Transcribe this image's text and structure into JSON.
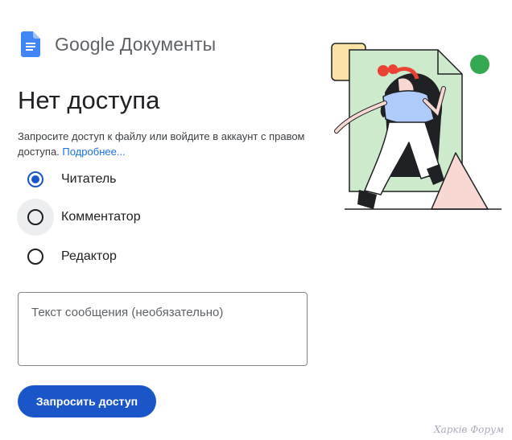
{
  "brand": {
    "google": "Google",
    "product": "Документы",
    "logo_icon": "google-docs-icon"
  },
  "title": "Нет доступа",
  "description": {
    "text": "Запросите доступ к файлу или войдите в аккаунт с правом доступа.",
    "link": "Подробнее..."
  },
  "roles": [
    {
      "label": "Читатель",
      "checked": true
    },
    {
      "label": "Комментатор",
      "checked": false
    },
    {
      "label": "Редактор",
      "checked": false
    }
  ],
  "message": {
    "placeholder": "Текст сообщения (необязательно)",
    "value": ""
  },
  "request_button": "Запросить доступ",
  "watermark": "Харків Форум",
  "colors": {
    "accent": "#1a56c7",
    "link": "#1a73e8",
    "illustration_green": "#ceeacd",
    "illustration_yellow": "#fbe3a6",
    "illustration_pink": "#f7d8d3",
    "dot_green": "#34a853",
    "hair_red": "#ea4335",
    "shirt_blue": "#aecbfa"
  }
}
